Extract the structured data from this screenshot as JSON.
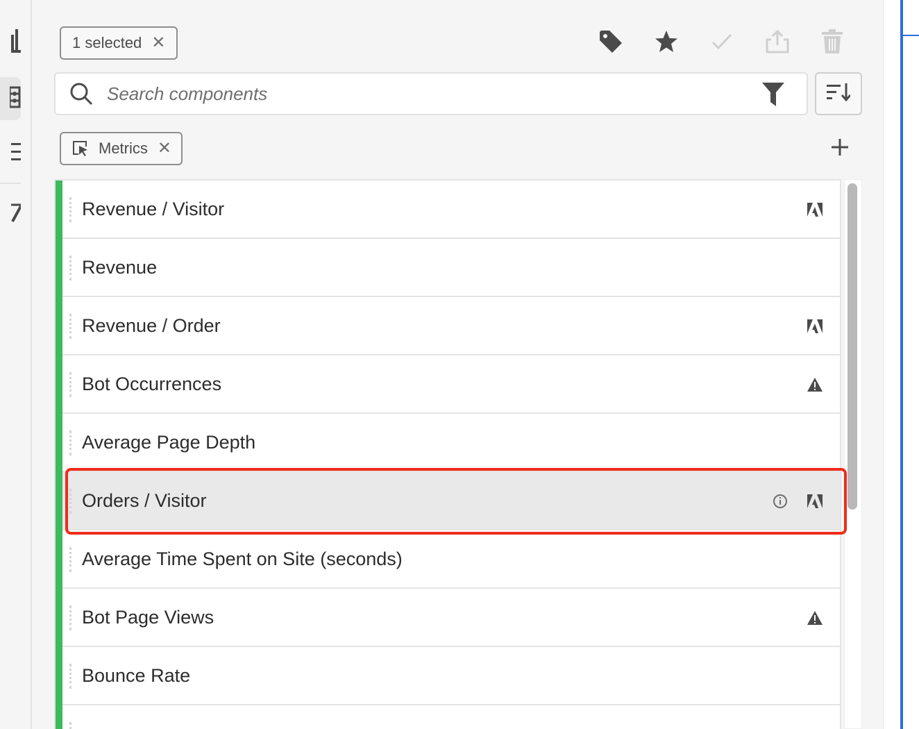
{
  "rail": {
    "items": [
      {
        "icon": "bar-chart-icon"
      },
      {
        "icon": "components-icon",
        "active": true
      },
      {
        "icon": "list-icon"
      },
      {
        "icon": "edit-icon"
      }
    ]
  },
  "selection_chip": {
    "label": "1 selected",
    "close": "✕"
  },
  "toolbar": {
    "icons": [
      "tag-icon",
      "star-icon",
      "approve-icon",
      "share-icon",
      "delete-icon"
    ]
  },
  "search": {
    "placeholder": "Search components"
  },
  "filter_chip": {
    "label": "Metrics",
    "close": "✕"
  },
  "metrics": [
    {
      "label": "Revenue / Visitor",
      "badge": "adobe-icon"
    },
    {
      "label": "Revenue",
      "badge": ""
    },
    {
      "label": "Revenue / Order",
      "badge": "adobe-icon"
    },
    {
      "label": "Bot Occurrences",
      "badge": "warning-icon"
    },
    {
      "label": "Average Page Depth",
      "badge": ""
    },
    {
      "label": "Orders / Visitor",
      "badge": "adobe-icon",
      "info": true,
      "highlighted": true
    },
    {
      "label": "Average Time Spent on Site (seconds)",
      "badge": ""
    },
    {
      "label": "Bot Page Views",
      "badge": "warning-icon"
    },
    {
      "label": "Bounce Rate",
      "badge": ""
    },
    {
      "label": "",
      "badge": ""
    }
  ],
  "colors": {
    "accent_green": "#3dba5e",
    "highlight_red": "#ee2c1a",
    "edge_blue": "#2e6fd9"
  }
}
